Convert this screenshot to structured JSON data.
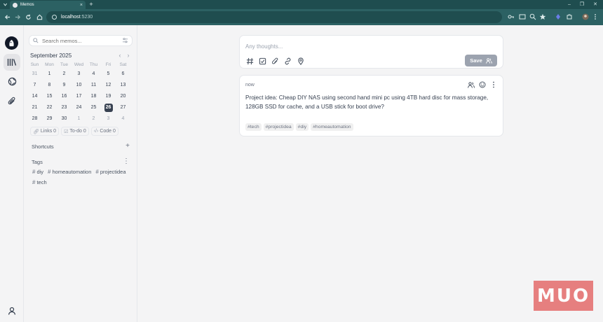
{
  "browser": {
    "tab_title": "Memos",
    "tab_close": "×",
    "new_tab": "+",
    "url_host": "localhost",
    "url_port": ":5230",
    "window_controls": [
      "–",
      "❐",
      "✕"
    ],
    "colors": {
      "frame": "#1f4d4f",
      "toolbar": "#2c6163"
    }
  },
  "sidebar": {
    "search_placeholder": "Search memos...",
    "calendar": {
      "month": "September 2025",
      "weekdays": [
        "Sun",
        "Mon",
        "Tue",
        "Wed",
        "Thu",
        "Fri",
        "Sat"
      ],
      "weeks": [
        [
          "31",
          "1",
          "2",
          "3",
          "4",
          "5",
          "6"
        ],
        [
          "7",
          "8",
          "9",
          "10",
          "11",
          "12",
          "13"
        ],
        [
          "14",
          "15",
          "16",
          "17",
          "18",
          "19",
          "20"
        ],
        [
          "21",
          "22",
          "23",
          "24",
          "25",
          "26",
          "27"
        ],
        [
          "28",
          "29",
          "30",
          "1",
          "2",
          "3",
          "4"
        ]
      ],
      "today": "26"
    },
    "stats": {
      "links": "Links 0",
      "todo": "To-do 0",
      "code": "Code 0"
    },
    "shortcuts_title": "Shortcuts",
    "shortcuts_add": "+",
    "tags_title": "Tags",
    "tags_menu": "⋮",
    "tags": [
      "diy",
      "homeautomation",
      "projectidea",
      "tech"
    ]
  },
  "editor": {
    "placeholder": "Any thoughts...",
    "save_label": "Save"
  },
  "memo": {
    "time": "now",
    "content": "Project idea: Cheap DIY NAS using second hand mini pc using 4TB hard disc for mass storage, 128GB SSD for cache, and a USB stick for boot drive?",
    "tags": [
      "#tech",
      "#projectidea",
      "#diy",
      "#homeautomation"
    ]
  },
  "watermark": "MUO"
}
